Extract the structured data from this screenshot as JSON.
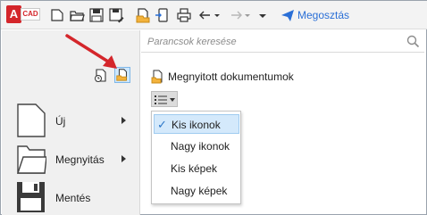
{
  "toolbar": {
    "app_letter": "A",
    "app_badge": "CAD",
    "share_label": "Megosztás",
    "icons": [
      "new-file-icon",
      "open-folder-icon",
      "save-icon",
      "save-as-icon",
      "open-file-icon",
      "share-phone-icon",
      "print-icon",
      "undo-icon",
      "redo-icon",
      "dropdown-icon",
      "send-icon"
    ]
  },
  "sidebar": {
    "tools": [
      "recent-clock-icon",
      "open-documents-icon"
    ],
    "items": [
      {
        "label": "Új",
        "icon": "new-document-icon",
        "has_submenu": true
      },
      {
        "label": "Megnyitás",
        "icon": "folder-icon",
        "has_submenu": true
      },
      {
        "label": "Mentés",
        "icon": "floppy-disk-icon",
        "has_submenu": false
      }
    ]
  },
  "search": {
    "placeholder": "Parancsok keresése",
    "icon": "search-icon"
  },
  "main": {
    "section_title": "Megnyitott dokumentumok",
    "view_menu": {
      "items": [
        {
          "label": "Kis ikonok",
          "checked": true
        },
        {
          "label": "Nagy ikonok",
          "checked": false
        },
        {
          "label": "Kis képek",
          "checked": false
        },
        {
          "label": "Nagy képek",
          "checked": false
        }
      ],
      "check_mark": "✓"
    }
  },
  "colors": {
    "accent_blue": "#2a6fd6",
    "app_red": "#d4262b",
    "annotation_arrow": "#d4262b",
    "selection": "#d4e9fb"
  }
}
